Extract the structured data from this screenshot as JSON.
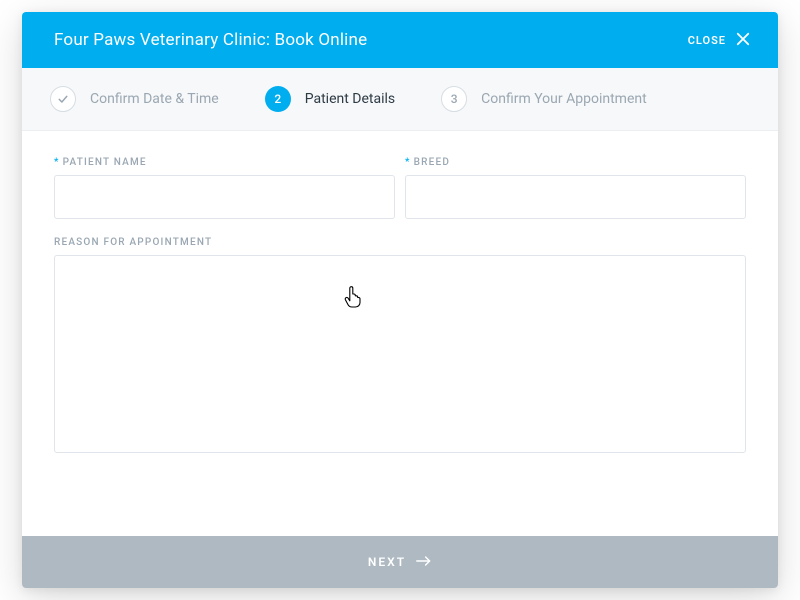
{
  "header": {
    "title": "Four Paws Veterinary Clinic: Book Online",
    "close_label": "CLOSE"
  },
  "stepper": {
    "steps": [
      {
        "indicator": "check",
        "label": "Confirm Date & Time",
        "state": "done"
      },
      {
        "indicator": "2",
        "label": "Patient Details",
        "state": "active"
      },
      {
        "indicator": "3",
        "label": "Confirm Your Appointment",
        "state": "pending"
      }
    ]
  },
  "form": {
    "patient_name": {
      "label": "PATIENT NAME",
      "required": true,
      "value": ""
    },
    "breed": {
      "label": "BREED",
      "required": true,
      "value": ""
    },
    "reason": {
      "label": "REASON FOR APPOINTMENT",
      "required": false,
      "value": ""
    }
  },
  "footer": {
    "next_label": "NEXT"
  },
  "required_marker": "*"
}
